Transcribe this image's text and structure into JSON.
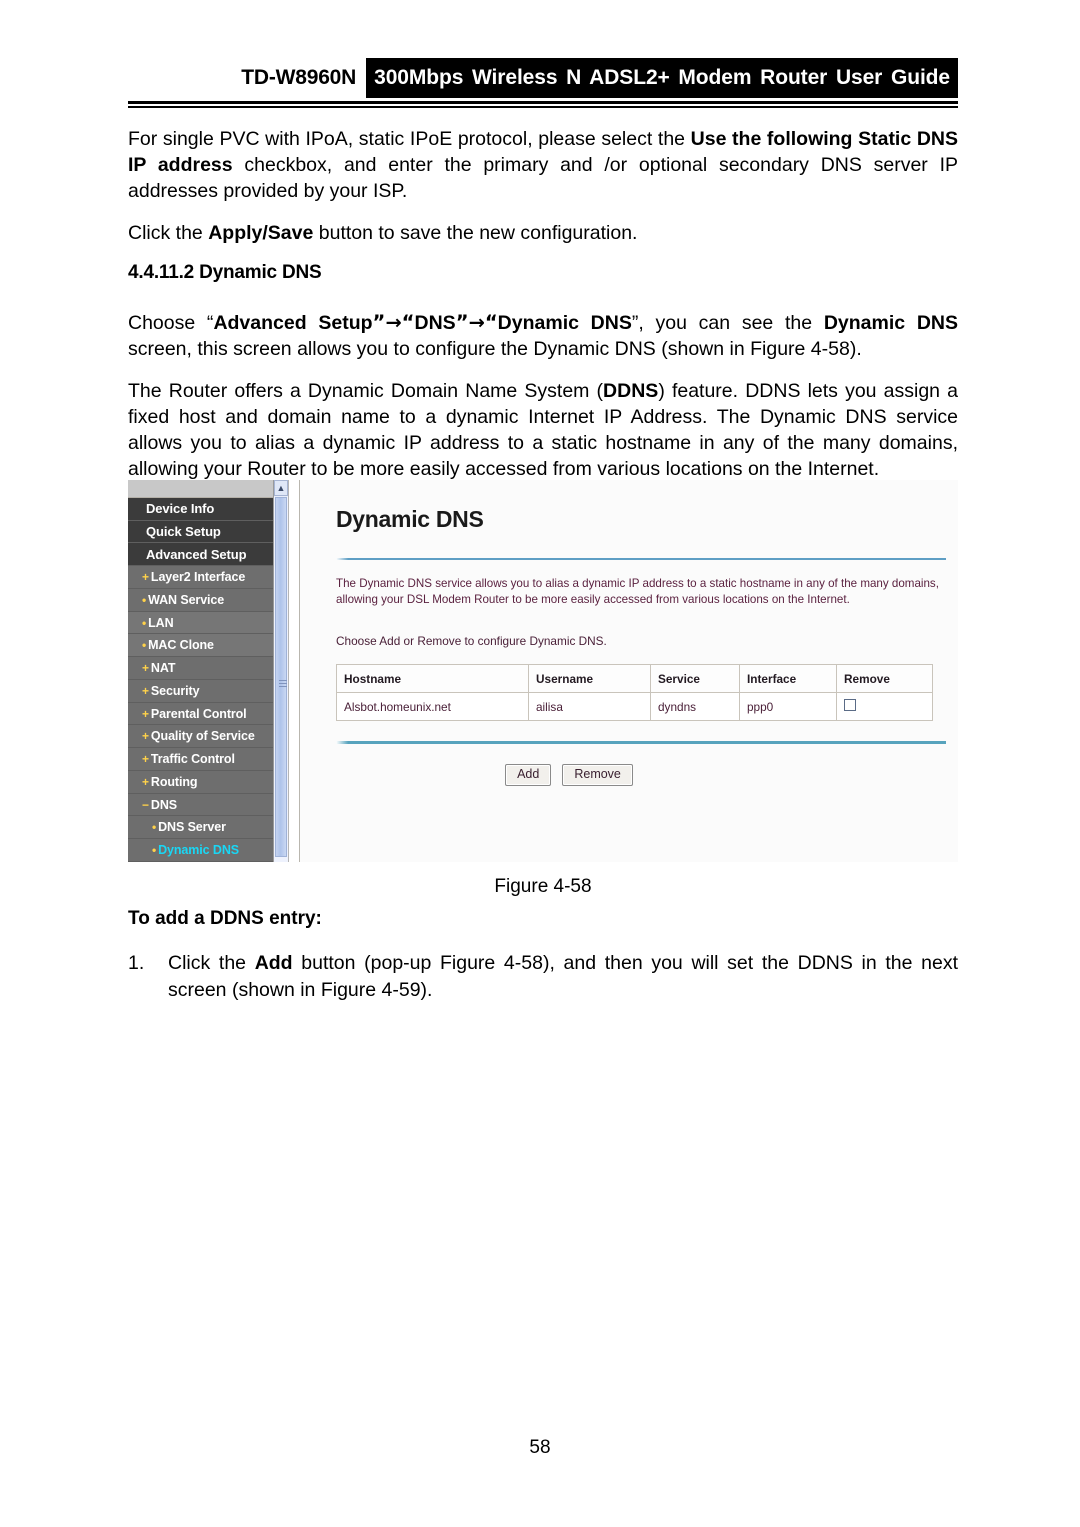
{
  "header": {
    "model": "TD-W8960N",
    "band_title": "300Mbps Wireless N ADSL2+ Modem Router User Guide"
  },
  "body": {
    "para1_a": "For single PVC with IPoA, static IPoE protocol, please select the ",
    "para1_b": "Use the following Static DNS IP address",
    "para1_c": " checkbox, and enter the primary and /or optional secondary DNS server IP addresses provided by your ISP.",
    "para2_a": "Click the ",
    "para2_b": "Apply/Save",
    "para2_c": " button to save the new configuration.",
    "section_heading": "4.4.11.2 Dynamic DNS",
    "para3_a": "Choose “",
    "para3_b": "Advanced Setup",
    "para3_arrow1": "”→“",
    "para3_c": "DNS",
    "para3_arrow2": "”→“",
    "para3_d": "Dynamic DNS",
    "para3_e": "”, you can see the ",
    "para3_f": "Dynamic DNS",
    "para3_g": " screen, this screen allows you to configure the Dynamic DNS (shown in Figure 4-58).",
    "para4_a": "The Router offers a Dynamic Domain Name System (",
    "para4_b": "DDNS",
    "para4_c": ") feature. DDNS lets you assign a fixed host and domain name to a dynamic Internet IP Address. The Dynamic DNS service allows you to alias a dynamic IP address to a static hostname in any of the many domains, allowing your Router to be more easily accessed from various locations on the Internet."
  },
  "figure": {
    "caption": "Figure 4-58",
    "sidebar": {
      "items": [
        {
          "label": "Device Info",
          "level": 0,
          "marker": "",
          "active": false
        },
        {
          "label": "Quick Setup",
          "level": 0,
          "marker": "",
          "active": false
        },
        {
          "label": "Advanced Setup",
          "level": 0,
          "marker": "",
          "active": false
        },
        {
          "label": "Layer2 Interface",
          "level": 1,
          "marker": "+",
          "active": false
        },
        {
          "label": "WAN Service",
          "level": 1,
          "marker": "•",
          "active": false
        },
        {
          "label": "LAN",
          "level": 1,
          "marker": "•",
          "active": false
        },
        {
          "label": "MAC Clone",
          "level": 1,
          "marker": "•",
          "active": false
        },
        {
          "label": "NAT",
          "level": 1,
          "marker": "+",
          "active": false
        },
        {
          "label": "Security",
          "level": 1,
          "marker": "+",
          "active": false
        },
        {
          "label": "Parental Control",
          "level": 1,
          "marker": "+",
          "active": false
        },
        {
          "label": "Quality of Service",
          "level": 1,
          "marker": "+",
          "active": false
        },
        {
          "label": "Traffic Control",
          "level": 1,
          "marker": "+",
          "active": false
        },
        {
          "label": "Routing",
          "level": 1,
          "marker": "+",
          "active": false
        },
        {
          "label": "DNS",
          "level": 1,
          "marker": "−",
          "active": false
        },
        {
          "label": "DNS Server",
          "level": 2,
          "marker": "•",
          "active": false
        },
        {
          "label": "Dynamic DNS",
          "level": 2,
          "marker": "•",
          "active": true
        }
      ]
    },
    "panel": {
      "title": "Dynamic DNS",
      "description": "The Dynamic DNS service allows you to alias a dynamic IP address to a static hostname in any of the many domains, allowing your DSL Modem Router to be more easily accessed from various locations on the Internet.",
      "instruction": "Choose Add or Remove to configure Dynamic DNS.",
      "table": {
        "columns": [
          "Hostname",
          "Username",
          "Service",
          "Interface",
          "Remove"
        ],
        "rows": [
          {
            "hostname": "Alsbot.homeunix.net",
            "username": "ailisa",
            "service": "dyndns",
            "interface": "ppp0",
            "remove_checked": false
          }
        ]
      },
      "buttons": {
        "add": "Add",
        "remove": "Remove"
      }
    },
    "colors": {
      "nav_level0_bg": "#3b3b3b",
      "nav_level1_bg": "#6e6e6e",
      "nav_marker": "#ffd24a",
      "nav_active_text": "#19d7f5",
      "panel_text": "#5b2240",
      "rule_blue": "#5e9ec4",
      "scrollbar": "#aec3ea"
    }
  },
  "after": {
    "subhead": "To add a DDNS entry:",
    "item1_num": "1.",
    "item1_a": "Click the ",
    "item1_b": "Add",
    "item1_c": " button (pop-up Figure 4-58), and then you will set the DDNS in the next screen (shown in Figure 4-59)."
  },
  "footer": {
    "page_number": "58"
  }
}
